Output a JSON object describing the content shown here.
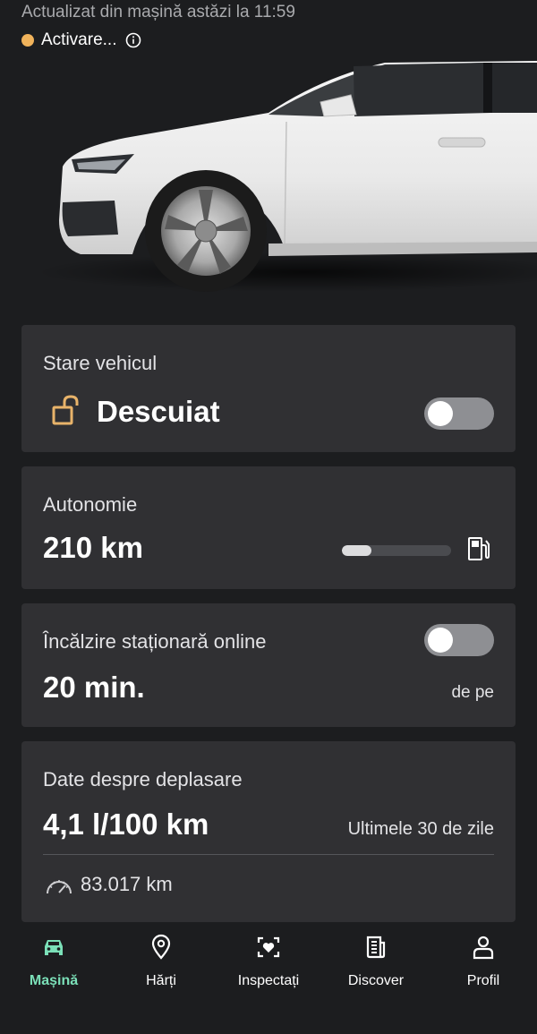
{
  "header": {
    "updated_text": "Actualizat din mașină astăzi la 11:59",
    "status_text": "Activare...",
    "status_color": "#f0b35b"
  },
  "vehicle_state": {
    "label": "Stare vehicul",
    "value": "Descuiat",
    "lock_icon": "unlocked-padlock-icon",
    "lock_icon_color": "#e8b36a",
    "toggle_on": false
  },
  "range": {
    "label": "Autonomie",
    "value": "210 km",
    "fuel_level": 0.27,
    "icon": "fuel-pump-icon"
  },
  "heating": {
    "label": "Încălzire staționară online",
    "value": "20 min.",
    "suffix": "de pe",
    "toggle_on": false
  },
  "trip": {
    "label": "Date despre deplasare",
    "consumption": "4,1 l/100 km",
    "period": "Ultimele 30 de zile",
    "odometer": "83.017 km",
    "odometer_icon": "speedometer-icon"
  },
  "nav": {
    "active_color": "#7be0b8",
    "items": [
      {
        "label": "Mașină",
        "icon": "car-icon",
        "active": true
      },
      {
        "label": "Hărți",
        "icon": "map-pin-icon",
        "active": false
      },
      {
        "label": "Inspectați",
        "icon": "scan-heart-icon",
        "active": false
      },
      {
        "label": "Discover",
        "icon": "news-icon",
        "active": false
      },
      {
        "label": "Profil",
        "icon": "person-icon",
        "active": false
      }
    ]
  }
}
